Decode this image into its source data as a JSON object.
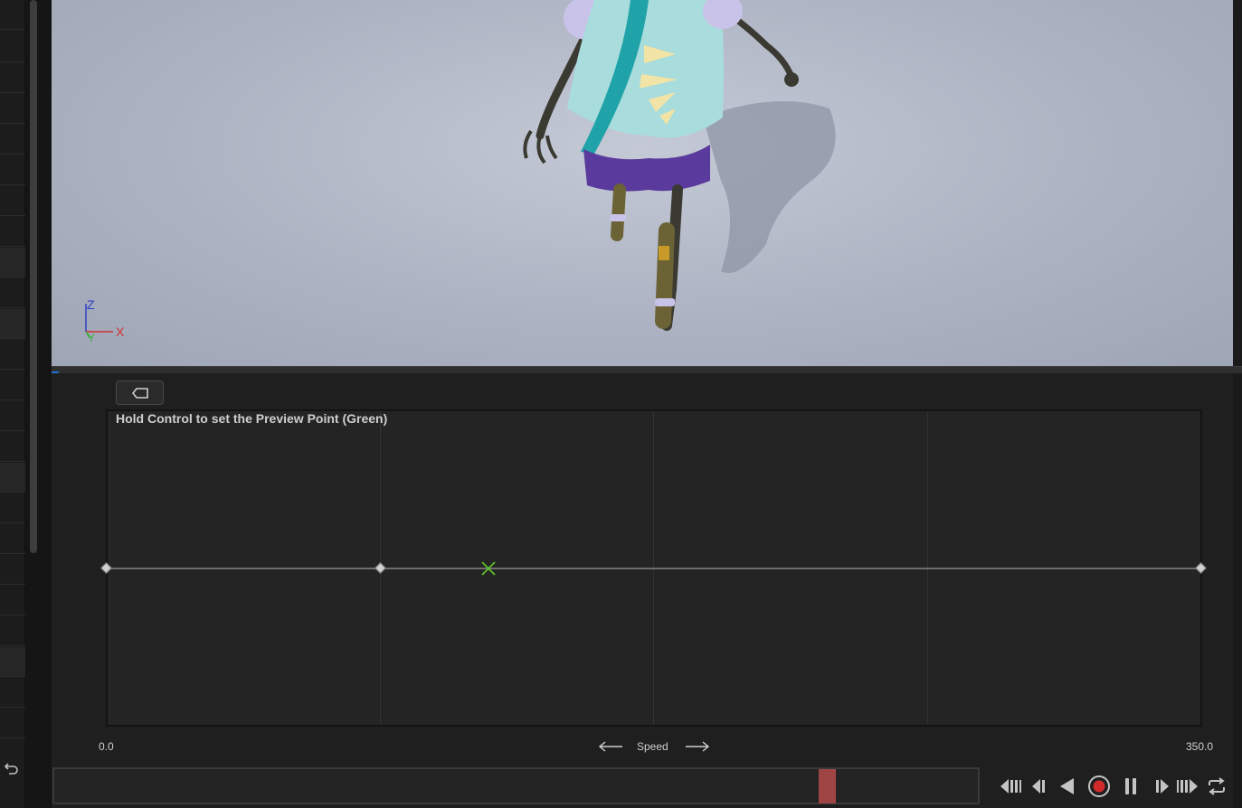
{
  "viewport": {
    "axis_gizmo": {
      "z": "Z",
      "x": "X",
      "y": "Y"
    }
  },
  "blend_space": {
    "hint": "Hold Control to set the Preview Point (Green)",
    "horizontal_axis": {
      "name": "Speed",
      "min_label": "0.0",
      "max_label": "350.0",
      "min": 0.0,
      "max": 350.0,
      "grid_divisions": 4
    },
    "samples": [
      0.0,
      87.5,
      350.0
    ],
    "preview_point": 122.0,
    "colors": {
      "preview": "#5fbf2a",
      "scrubber": "#a04545",
      "record": "#d12a2a"
    }
  },
  "timeline": {
    "scrub_position": 0.83
  },
  "transport": [
    {
      "name": "to-start-button",
      "icon": "skip-to-start-icon"
    },
    {
      "name": "step-back-button",
      "icon": "step-back-icon"
    },
    {
      "name": "play-reverse-button",
      "icon": "play-reverse-icon"
    },
    {
      "name": "record-button",
      "icon": "record-icon"
    },
    {
      "name": "pause-button",
      "icon": "pause-icon"
    },
    {
      "name": "step-forward-button",
      "icon": "step-forward-icon"
    },
    {
      "name": "to-end-button",
      "icon": "skip-to-end-icon"
    },
    {
      "name": "loop-button",
      "icon": "loop-icon"
    }
  ]
}
